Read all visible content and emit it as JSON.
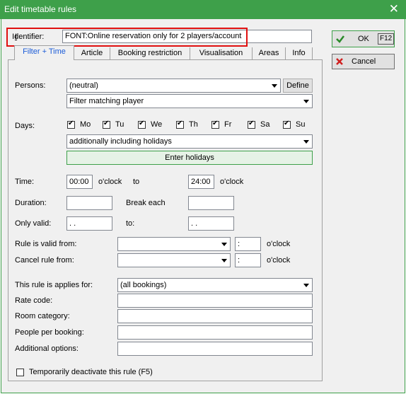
{
  "window": {
    "title": "Edit timetable rules"
  },
  "identifier": {
    "label": "Identifier:",
    "value": "FONT:Online reservation only for 2 players/account"
  },
  "tabs": [
    "Filter + Time",
    "Article",
    "Booking restriction",
    "Visualisation",
    "Areas",
    "Info"
  ],
  "persons": {
    "label": "Persons:",
    "value": "(neutral)",
    "define_label": "Define",
    "filter_value": "Filter matching player"
  },
  "days": {
    "label": "Days:",
    "items": [
      {
        "label": "Mo",
        "checked": true
      },
      {
        "label": "Tu",
        "checked": true
      },
      {
        "label": "We",
        "checked": true
      },
      {
        "label": "Th",
        "checked": true
      },
      {
        "label": "Fr",
        "checked": true
      },
      {
        "label": "Sa",
        "checked": true
      },
      {
        "label": "Su",
        "checked": true
      }
    ],
    "holiday_mode": "additionally including holidays",
    "enter_holidays_label": "Enter holidays"
  },
  "time": {
    "label": "Time:",
    "from": "00:00",
    "oclock": "o'clock",
    "to_label": "to",
    "to": "24:00",
    "oclock2": "o'clock"
  },
  "duration": {
    "label": "Duration:",
    "value": "",
    "break_label": "Break each",
    "break_value": ""
  },
  "only_valid": {
    "label": "Only valid:",
    "from": " .  .",
    "to_label": "to:",
    "to": " .  ."
  },
  "rule_valid_from": {
    "label": "Rule is valid from:",
    "date": "",
    "time": " :",
    "oclock": "o'clock"
  },
  "cancel_rule_from": {
    "label": "Cancel rule from:",
    "date": "",
    "time": " :",
    "oclock": "o'clock"
  },
  "applies_for": {
    "label": "This rule is applies for:",
    "value": "(all bookings)"
  },
  "rate_code": {
    "label": "Rate code:",
    "value": ""
  },
  "room_category": {
    "label": "Room category:",
    "value": ""
  },
  "people_per_booking": {
    "label": "People per booking:",
    "value": ""
  },
  "additional_options": {
    "label": "Additional options:",
    "value": ""
  },
  "deactivate": {
    "label": "Temporarily deactivate this rule (F5)",
    "checked": false
  },
  "side_buttons": {
    "ok_label": "OK",
    "ok_key": "F12",
    "cancel_label": "Cancel"
  },
  "colors": {
    "titlebar": "#3ea04a",
    "highlight": "#e01010",
    "active_tab_text": "#1a5bd8"
  }
}
